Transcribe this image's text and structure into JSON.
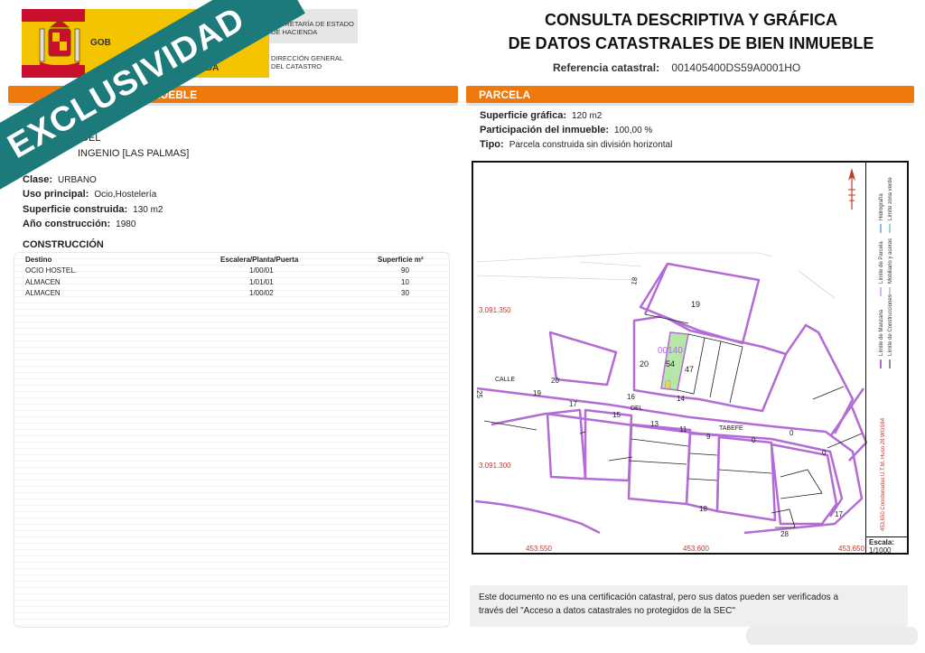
{
  "header": {
    "gov_left_1": "GOB",
    "gov_left_2": "ENDA",
    "ministry_line1": "SECRETARÍA DE ESTADO",
    "ministry_line2": "DE HACIENDA",
    "directorate_line1": "DIRECCIÓN GENERAL",
    "directorate_line2": "DEL CATASTRO",
    "title_line1": "CONSULTA DESCRIPTIVA Y GRÁFICA",
    "title_line2": "DE DATOS CATASTRALES DE BIEN INMUEBLE",
    "ref_label": "Referencia catastral:",
    "ref_value": "001405400DS59A0001HO"
  },
  "ribbon": {
    "text": "EXCLUSIVIDAD"
  },
  "left": {
    "section_title": "EL INMUEBLE",
    "address_line1": "DEL",
    "address_line2": "INGENIO [LAS PALMAS]",
    "clase_label": "Clase:",
    "clase_value": "URBANO",
    "uso_label": "Uso principal:",
    "uso_value": "Ocio,Hostelería",
    "sup_label": "Superficie construida:",
    "sup_value": "130 m2",
    "anio_label": "Año construcción:",
    "anio_value": "1980",
    "construccion_title": "CONSTRUCCIÓN",
    "table": {
      "headers": [
        "Destino",
        "Escalera/Planta/Puerta",
        "Superficie m²"
      ],
      "rows": [
        [
          "OCIO HOSTEL.",
          "1/00/01",
          "90"
        ],
        [
          "ALMACEN",
          "1/01/01",
          "10"
        ],
        [
          "ALMACEN",
          "1/00/02",
          "30"
        ]
      ]
    }
  },
  "right": {
    "section_title": "PARCELA",
    "sup_label": "Superficie gráfica:",
    "sup_value": "120 m2",
    "part_label": "Participación del inmueble:",
    "part_value": "100,00 %",
    "tipo_label": "Tipo:",
    "tipo_value": "Parcela construida sin división horizontal",
    "map": {
      "coord_y1": "3.091.350",
      "coord_y2": "3.091.300",
      "coord_x1": "453.550",
      "coord_x2": "453.600",
      "coord_x3": "453.650",
      "parcel_label": "00140",
      "street_labels": [
        "CALLE",
        "DEL",
        "TABEFE"
      ],
      "numbers": [
        "18",
        "19",
        "20",
        "54",
        "47",
        "20",
        "16",
        "14",
        "19",
        "17",
        "15",
        "13",
        "11",
        "9",
        "0",
        "0",
        "0",
        "25",
        "18",
        "28",
        "17"
      ],
      "legend": [
        "Límite de Manzana",
        "Límite de Parcela",
        "Límite de Construcciones",
        "Mobiliario y aceras",
        "Límite zona verde",
        "Hidrografía"
      ],
      "coords_note": "453,650 Coordenadas U.T.M. Huso 28 WGS84",
      "scale_label": "Escala:",
      "scale_value": "1/1000"
    }
  },
  "note": {
    "line1": "Este documento no es una certificación catastral, pero sus datos pueden ser verificados a",
    "line2": "través del \"Acceso a datos catastrales no protegidos de la SEC\""
  },
  "colors": {
    "orange": "#ee7a0c",
    "ribbon": "#1d7a7b",
    "parcel": "#b36bd6",
    "highlight": "#b6e6a8"
  }
}
